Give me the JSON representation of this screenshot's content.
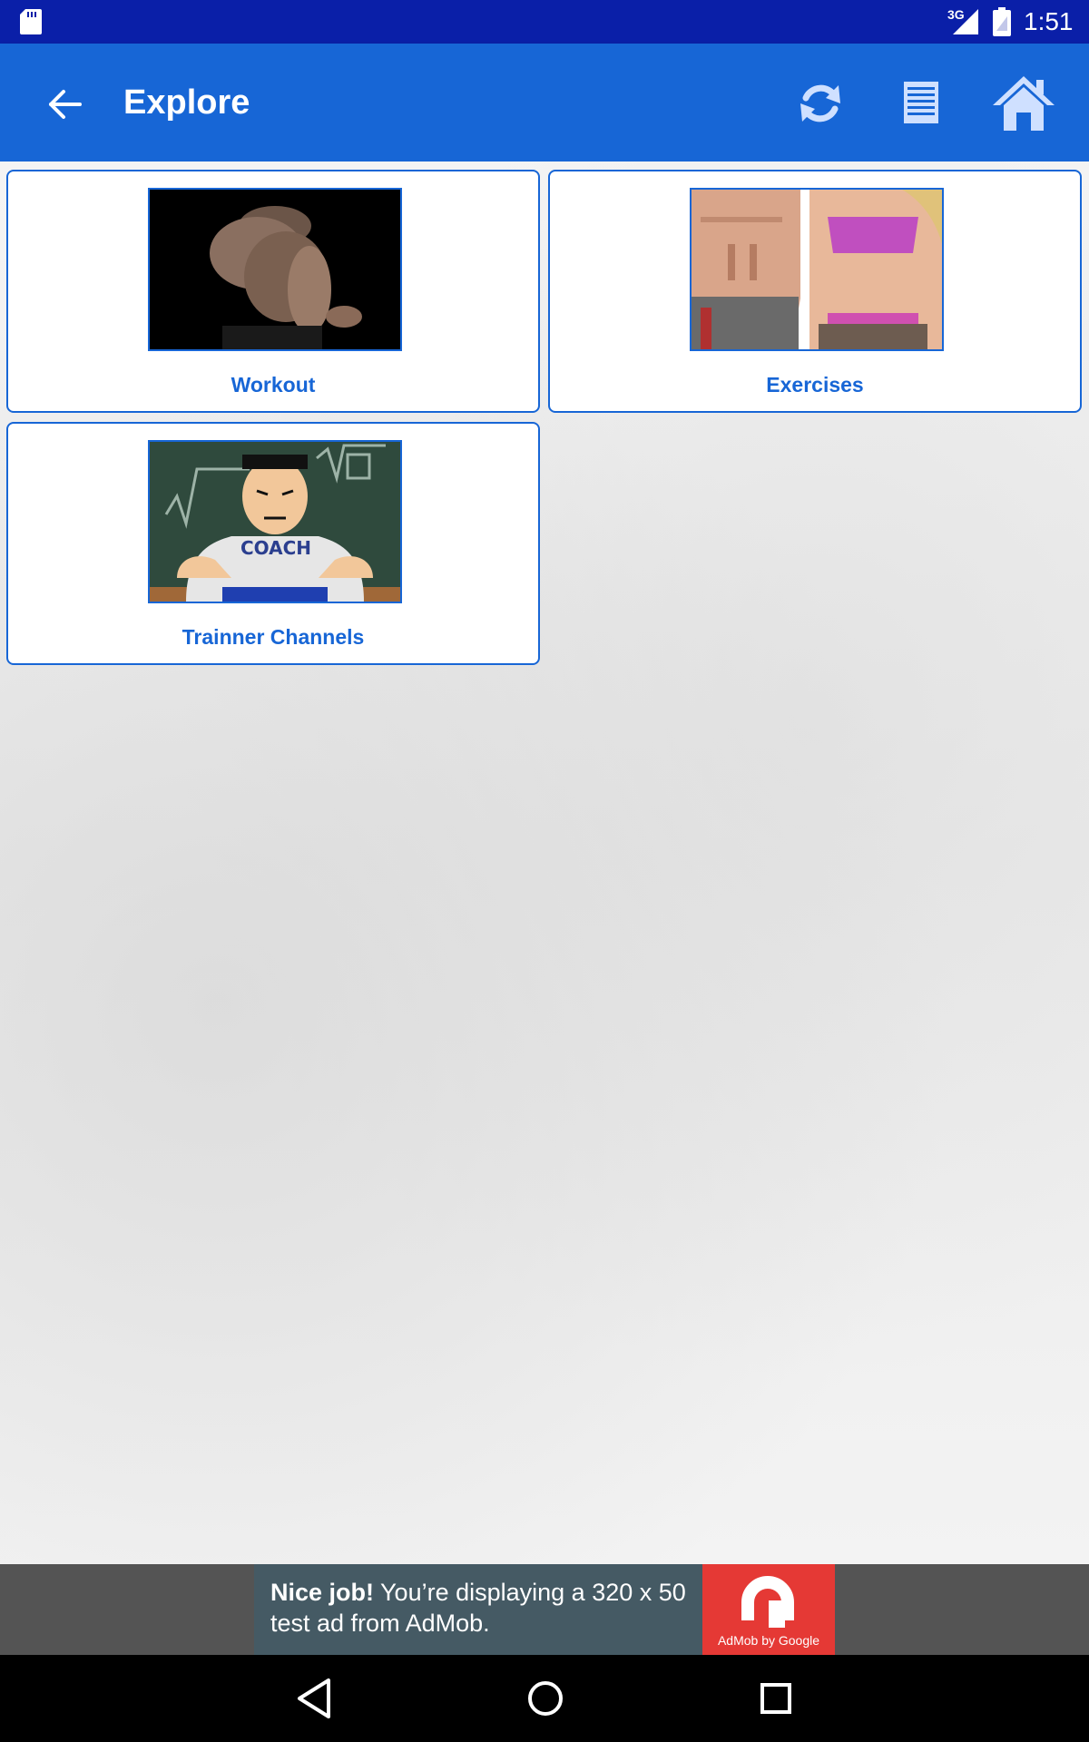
{
  "status_bar": {
    "network": "3G",
    "time": "1:51",
    "icons": [
      "sd-card-icon",
      "signal-icon",
      "battery-icon"
    ]
  },
  "app_bar": {
    "title": "Explore",
    "color": "#1766d6",
    "icons": [
      "back-arrow-icon",
      "refresh-icon",
      "list-icon",
      "home-icon"
    ]
  },
  "cards": [
    {
      "label": "Workout",
      "image": "muscular-man-photo"
    },
    {
      "label": "Exercises",
      "image": "fit-couple-abs-photo"
    },
    {
      "label": "Trainner Channels",
      "image": "coach-cartoon-image"
    }
  ],
  "ad": {
    "headline": "Nice job!",
    "body": " You’re displaying a 320 x 50 test ad from AdMob.",
    "logo_text": "AdMob by Google"
  },
  "nav_bar": {
    "icons": [
      "nav-back-icon",
      "nav-home-icon",
      "nav-recents-icon"
    ]
  }
}
